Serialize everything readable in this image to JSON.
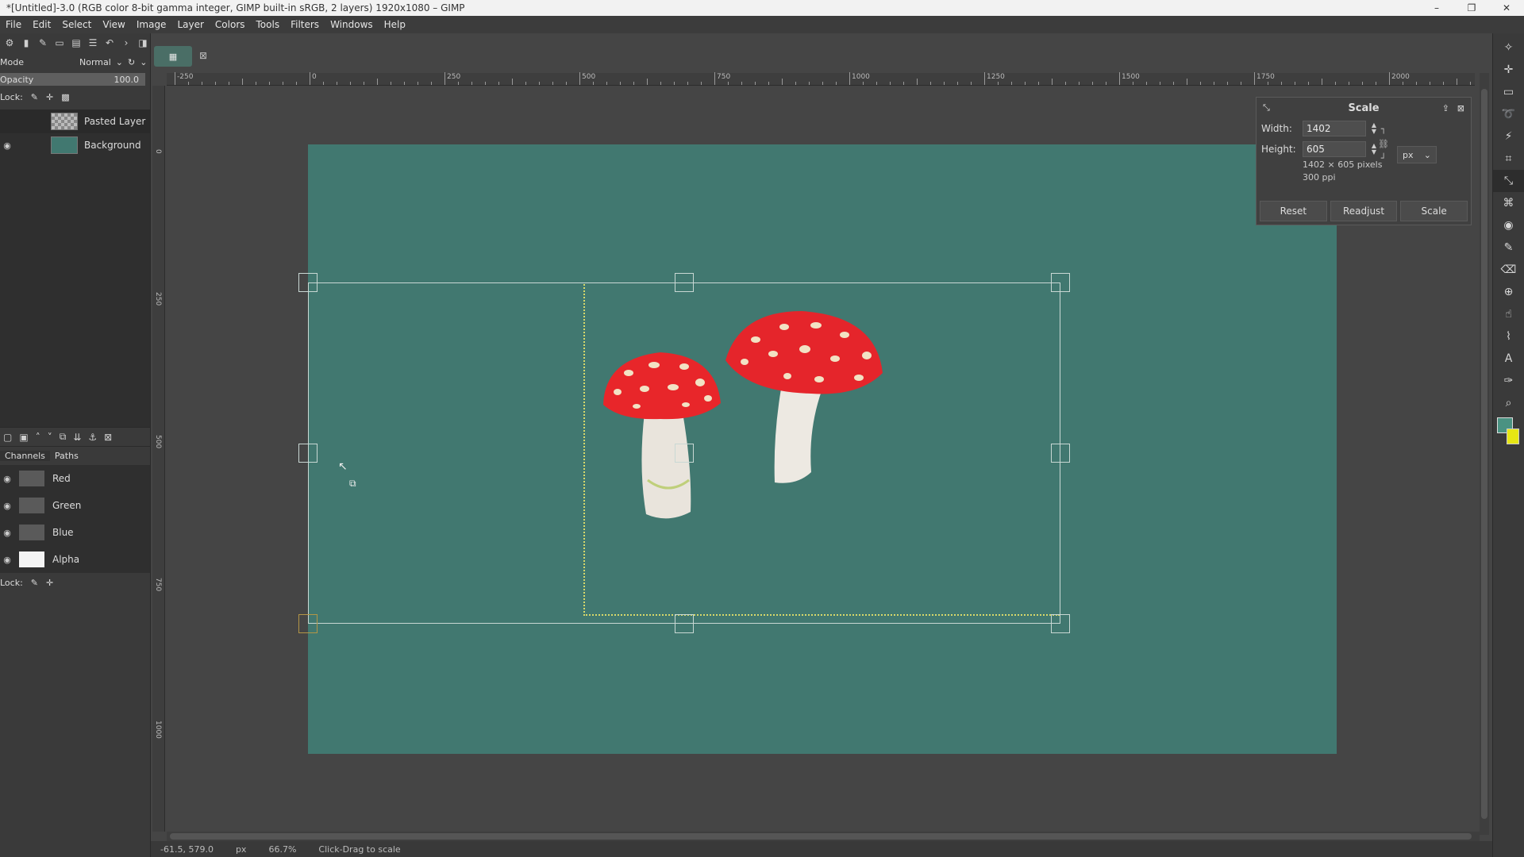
{
  "window": {
    "title": "*[Untitled]-3.0 (RGB color 8-bit gamma integer, GIMP built-in sRGB, 2 layers) 1920x1080 – GIMP",
    "min": "–",
    "max": "❐",
    "close": "✕"
  },
  "menu": [
    "File",
    "Edit",
    "Select",
    "View",
    "Image",
    "Layer",
    "Colors",
    "Tools",
    "Filters",
    "Windows",
    "Help"
  ],
  "layers_panel": {
    "mode_label": "Mode",
    "mode_value": "Normal",
    "opacity_label": "Opacity",
    "opacity_value": "100.0",
    "lock_label": "Lock:",
    "layers": [
      {
        "name": "Pasted Layer",
        "visible": false
      },
      {
        "name": "Background",
        "visible": true
      }
    ]
  },
  "channels_panel": {
    "tabs": [
      "Channels",
      "Paths"
    ],
    "channels": [
      "Red",
      "Green",
      "Blue",
      "Alpha"
    ],
    "lock_label": "Lock:"
  },
  "ruler": {
    "top_labels": [
      "-250",
      "0",
      "250",
      "500",
      "750",
      "1000",
      "1250",
      "1500",
      "1750",
      "2000"
    ],
    "left_labels": [
      "0",
      "250",
      "500",
      "750",
      "1000"
    ]
  },
  "scale_dialog": {
    "title": "Scale",
    "width_label": "Width:",
    "width_value": "1402",
    "height_label": "Height:",
    "height_value": "605",
    "unit": "px",
    "info_pixels": "1402 × 605 pixels",
    "info_ppi": "300 ppi",
    "buttons": {
      "reset": "Reset",
      "readjust": "Readjust",
      "scale": "Scale"
    }
  },
  "statusbar": {
    "coords": "-61.5, 579.0",
    "unit": "px",
    "zoom": "66.7%",
    "message": "Click-Drag to scale"
  },
  "colors": {
    "canvas": "#417870",
    "foreground": "#4a9282",
    "background": "#e6e614"
  }
}
